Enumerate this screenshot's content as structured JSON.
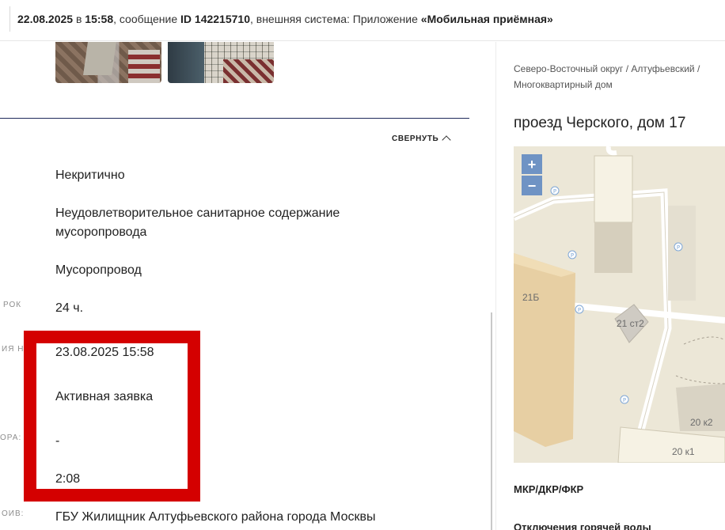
{
  "header": {
    "date": "22.08.2025",
    "at": " в ",
    "time": "15:58",
    "message_prefix": ", сообщение ",
    "message_id": "ID 142215710",
    "system_prefix": ", внешняя система: Приложение ",
    "system_name": "«Мобильная приёмная»"
  },
  "details": {
    "collapse_label": "СВЕРНУТЬ",
    "fields": [
      {
        "label": "",
        "value": "Некритично"
      },
      {
        "label": "",
        "value": "Неудовлетворительное санитарное содержание мусоропровода"
      },
      {
        "label": "",
        "value": "Мусоропровод"
      },
      {
        "label": "РОК",
        "value": "24 ч."
      },
      {
        "label": "ИЯ Н",
        "value": "23.08.2025 15:58"
      },
      {
        "label": "",
        "value": "Активная заявка"
      },
      {
        "label": "ОРА:",
        "value": "-"
      },
      {
        "label": "",
        "value": "2:08"
      },
      {
        "label": "ОИВ:",
        "value": "ГБУ Жилищник Алтуфьевского района города Москвы"
      }
    ]
  },
  "sidebar": {
    "breadcrumb_line1": "Северо-Восточный округ / Алтуфьевский /",
    "breadcrumb_line2": "Многоквартирный дом",
    "address": "проезд Черского, дом 17",
    "map": {
      "zoom_in": "+",
      "zoom_out": "−",
      "labels": [
        "21Б",
        "21 ст2",
        "20 к2",
        "20 к1"
      ]
    },
    "section1": "МКР/ДКР/ФКР",
    "section2": "Отключения горячей воды"
  },
  "colors": {
    "highlight_border": "#d40000",
    "divider": "#1e2a5a",
    "map_zoom": "#6f93c4"
  }
}
